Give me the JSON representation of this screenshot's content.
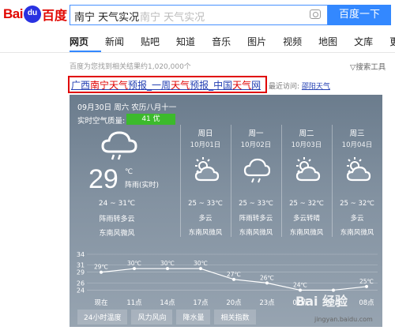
{
  "header": {
    "logo_bai": "Bai",
    "logo_paw": "du",
    "logo_du": "百度",
    "query": "南宁 天气实况",
    "placeholder": "南宁 天气实况",
    "search_button": "百度一下"
  },
  "tabs": [
    "网页",
    "新闻",
    "贴吧",
    "知道",
    "音乐",
    "图片",
    "视频",
    "地图",
    "文库",
    "更多»"
  ],
  "result_count": "百度为您找到相关结果约1,020,000个",
  "search_tools": "▽搜索工具",
  "result": {
    "title_parts": [
      {
        "text": "广西",
        "em": false
      },
      {
        "text": "南宁",
        "em": true
      },
      {
        "text": "天气",
        "em": true
      },
      {
        "text": "预报_一周",
        "em": false
      },
      {
        "text": "天气",
        "em": true
      },
      {
        "text": "预报_中国",
        "em": false
      },
      {
        "text": "天气",
        "em": true
      },
      {
        "text": "网",
        "em": false
      }
    ],
    "recent_label": "最近访问:",
    "recent_link": "邵阳天气"
  },
  "weather": {
    "date": "09月30日 周六 农历八月十一",
    "aqi_label": "实时空气质量:",
    "aqi_value": "41 优",
    "today": {
      "temp": "29",
      "unit": "℃",
      "condition": "阵雨(实时)",
      "range": "24 ~ 31℃",
      "wind": "阵雨转多云",
      "wind_level": "东南风微风",
      "icon": "cloud-rain-icon"
    },
    "days": [
      {
        "name": "周日",
        "date": "10月01日",
        "range": "25 ~ 33℃",
        "cond": "多云",
        "wind": "东南风微风",
        "icon": "partly-cloudy-icon"
      },
      {
        "name": "周一",
        "date": "10月02日",
        "range": "25 ~ 33℃",
        "cond": "阵雨转多云",
        "wind": "东南风微风",
        "icon": "cloud-rain-icon"
      },
      {
        "name": "周二",
        "date": "10月03日",
        "range": "25 ~ 32℃",
        "cond": "多云转晴",
        "wind": "东南风微风",
        "icon": "partly-cloudy-icon"
      },
      {
        "name": "周三",
        "date": "10月04日",
        "range": "25 ~ 32℃",
        "cond": "多云",
        "wind": "东南风微风",
        "icon": "partly-cloudy-icon"
      }
    ],
    "bottom_tabs": [
      "24小时温度",
      "风力风向",
      "降水量",
      "相关指数"
    ]
  },
  "chart_data": {
    "type": "line",
    "x": [
      "现在",
      "11点",
      "14点",
      "17点",
      "20点",
      "23点",
      "02点",
      "05点",
      "08点"
    ],
    "values": [
      29,
      30,
      30,
      30,
      27,
      26,
      24,
      24,
      25
    ],
    "labels": [
      "29℃",
      "30℃",
      "30℃",
      "30℃",
      "27℃",
      "26℃",
      "24℃",
      "",
      "25℃"
    ],
    "yticks": [
      24,
      26,
      29,
      31,
      34
    ],
    "ylim": [
      23,
      34
    ]
  },
  "watermark": "Bai 经验",
  "watermark_url": "jingyan.baidu.com"
}
